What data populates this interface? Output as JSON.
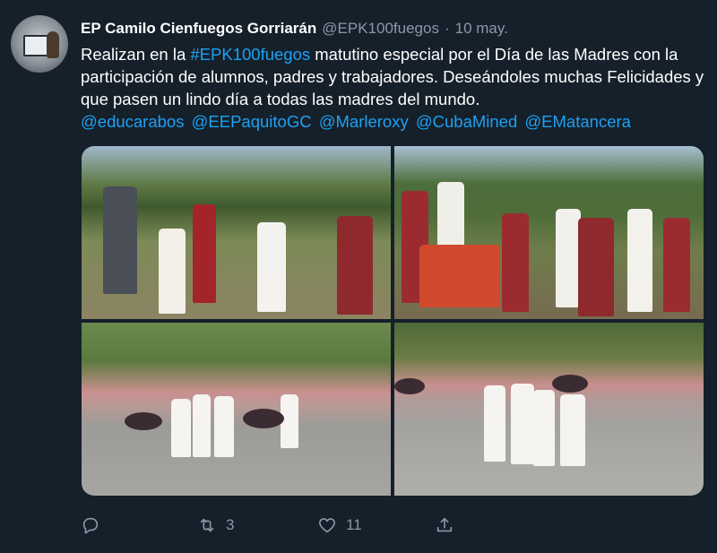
{
  "tweet": {
    "author_name": "EP Camilo Cienfuegos Gorriarán",
    "handle": "@EPK100fuegos",
    "separator": "·",
    "date": "10 may.",
    "text_before": "Realizan en la ",
    "hashtag": "#EPK100fuegos",
    "text_after": " matutino especial por el Día de las Madres con la participación de alumnos, padres y trabajadores. Deseándoles muchas Felicidades y que pasen un lindo día a todas las madres del mundo.",
    "mentions": [
      "@educarabos",
      "@EEPaquitoGC",
      "@Marleroxy",
      "@CubaMined",
      "@EMatancera"
    ]
  },
  "actions": {
    "retweet_count": "3",
    "like_count": "11"
  },
  "colors": {
    "background": "#15202b",
    "link": "#1da1f2",
    "secondary_text": "#8899a6"
  },
  "icons": [
    "reply-icon",
    "retweet-icon",
    "like-icon",
    "share-icon"
  ]
}
